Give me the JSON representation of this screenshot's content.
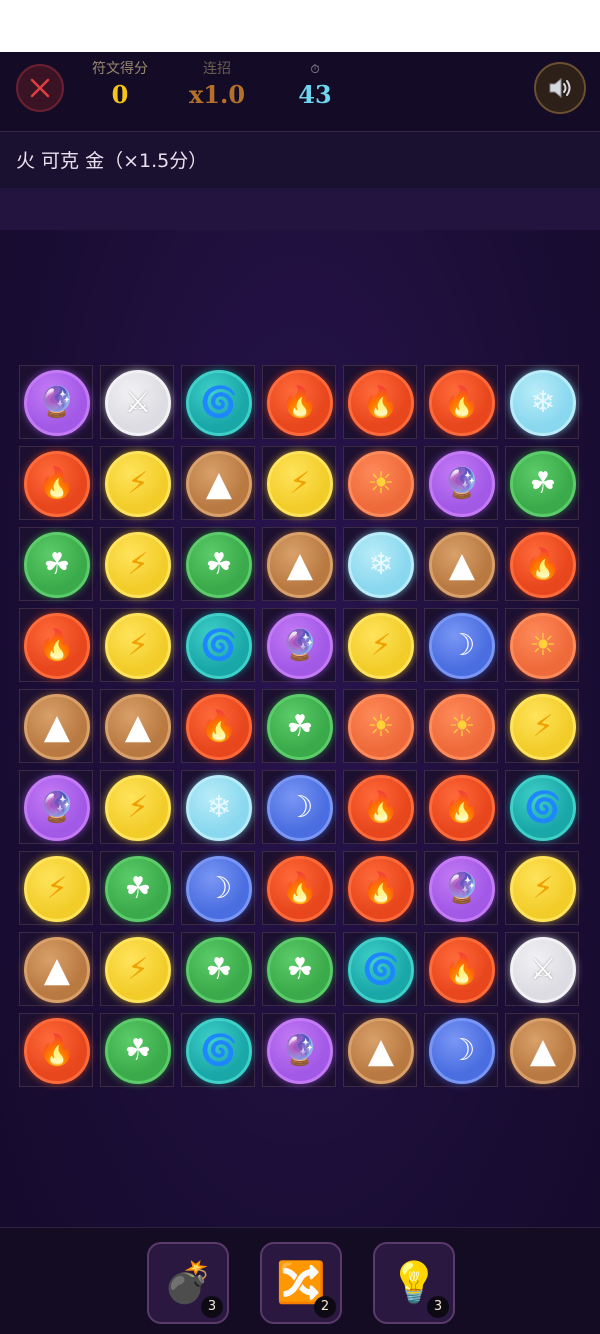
{
  "header": {
    "score": {
      "label": "符文得分",
      "value": "0",
      "color": "#f5c518"
    },
    "combo": {
      "label": "连招",
      "value": "x1.0",
      "color": "#b7702a"
    },
    "timer": {
      "icon": "⏱",
      "value": "43",
      "color": "#6fd6f0"
    },
    "close_icon": "close-icon",
    "sound_icon": "speaker-icon"
  },
  "hint": "火 可克 金（×1.5分）",
  "orb_types": {
    "orb": {
      "glyph": "🔮",
      "name": "crystal-ball",
      "bg": "#a259e6",
      "ring": "#c47af5"
    },
    "swd": {
      "glyph": "⚔",
      "name": "swords",
      "bg": "#dcdce2",
      "ring": "#f2f2f5"
    },
    "swl": {
      "glyph": "🌀",
      "name": "swirl",
      "bg": "#1aa7a8",
      "ring": "#3fd0c8"
    },
    "fir": {
      "glyph": "🔥",
      "name": "fire",
      "bg": "#e8461c",
      "ring": "#ff6a3a"
    },
    "ice": {
      "glyph": "❄",
      "name": "snowflake",
      "bg": "#8ad8ef",
      "ring": "#b8ecf8"
    },
    "bol": {
      "glyph": "⚡",
      "name": "lightning",
      "bg": "#f2cd2a",
      "ring": "#ffe35a"
    },
    "mnt": {
      "glyph": "▲",
      "name": "mountain",
      "bg": "#b97a42",
      "ring": "#d9a06a"
    },
    "sun": {
      "glyph": "☀",
      "name": "sun",
      "bg": "#ef6a3a",
      "ring": "#ff8a5a"
    },
    "clv": {
      "glyph": "☘",
      "name": "clover",
      "bg": "#3aaa4a",
      "ring": "#5ccc6a"
    },
    "mon": {
      "glyph": "☽",
      "name": "moon",
      "bg": "#4a6ee0",
      "ring": "#7a96f5"
    }
  },
  "grid": [
    [
      "orb",
      "swd",
      "swl",
      "fir",
      "fir",
      "fir",
      "ice"
    ],
    [
      "fir",
      "bol",
      "mnt",
      "bol",
      "sun",
      "orb",
      "clv"
    ],
    [
      "clv",
      "bol",
      "clv",
      "mnt",
      "ice",
      "mnt",
      "fir"
    ],
    [
      "fir",
      "bol",
      "swl",
      "orb",
      "bol",
      "mon",
      "sun"
    ],
    [
      "mnt",
      "mnt",
      "fir",
      "clv",
      "sun",
      "sun",
      "bol"
    ],
    [
      "orb",
      "bol",
      "ice",
      "mon",
      "fir",
      "fir",
      "swl"
    ],
    [
      "bol",
      "clv",
      "mon",
      "fir",
      "fir",
      "orb",
      "bol"
    ],
    [
      "mnt",
      "bol",
      "clv",
      "clv",
      "swl",
      "fir",
      "swd"
    ],
    [
      "fir",
      "clv",
      "swl",
      "orb",
      "mnt",
      "mon",
      "mnt"
    ]
  ],
  "tools": [
    {
      "icon": "bomb-icon",
      "glyph": "💣",
      "count": "3"
    },
    {
      "icon": "shuffle-icon",
      "glyph": "🔀",
      "count": "2"
    },
    {
      "icon": "lightbulb-icon",
      "glyph": "💡",
      "count": "3"
    }
  ]
}
